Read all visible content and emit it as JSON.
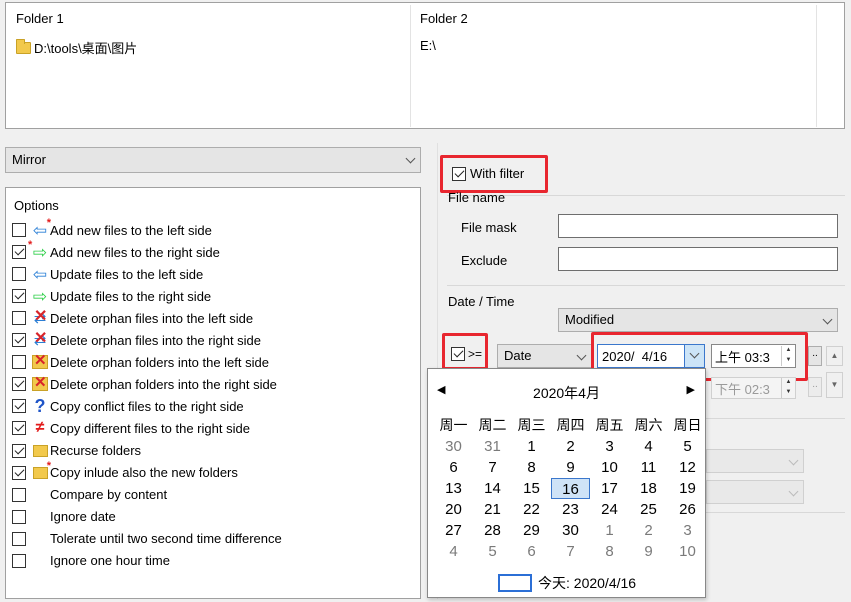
{
  "folders": {
    "left_header": "Folder 1",
    "left_path": "D:\\tools\\桌面\\图片",
    "right_header": "Folder 2",
    "right_path": "E:\\"
  },
  "mode": {
    "selected": "Mirror"
  },
  "options": {
    "title": "Options",
    "items": [
      {
        "label": "Add new files to the left side",
        "checked": false,
        "icon": "add-left-arrow-icon"
      },
      {
        "label": "Add new files to the right side",
        "checked": true,
        "icon": "add-right-arrow-icon"
      },
      {
        "label": "Update files to the left side",
        "checked": false,
        "icon": "left-arrow-icon"
      },
      {
        "label": "Update files to the right side",
        "checked": true,
        "icon": "right-arrow-icon"
      },
      {
        "label": "Delete orphan files into the left side",
        "checked": false,
        "icon": "delete-files-icon"
      },
      {
        "label": "Delete orphan files into the right side",
        "checked": true,
        "icon": "delete-files-icon"
      },
      {
        "label": "Delete orphan folders into the left side",
        "checked": false,
        "icon": "delete-folder-icon"
      },
      {
        "label": "Delete orphan folders into the right side",
        "checked": true,
        "icon": "delete-folder-icon"
      },
      {
        "label": "Copy conflict files to the right side",
        "checked": true,
        "icon": "question-icon"
      },
      {
        "label": "Copy different files to the right side",
        "checked": true,
        "icon": "not-equal-icon"
      },
      {
        "label": "Recurse folders",
        "checked": true,
        "icon": "folder-icon"
      },
      {
        "label": "Copy inlude also the new folders",
        "checked": true,
        "icon": "new-folder-icon"
      },
      {
        "label": "Compare by content",
        "checked": false,
        "icon": ""
      },
      {
        "label": "Ignore date",
        "checked": false,
        "icon": ""
      },
      {
        "label": "Tolerate until two second time difference",
        "checked": false,
        "icon": ""
      },
      {
        "label": "Ignore one hour time",
        "checked": false,
        "icon": ""
      }
    ]
  },
  "filter": {
    "with_filter_label": "With filter",
    "file_name_group": "File name",
    "file_mask_label": "File mask",
    "file_mask_value": "",
    "exclude_label": "Exclude",
    "exclude_value": "",
    "datetime_group": "Date / Time",
    "modified_select": "Modified",
    "op1": ">=",
    "date_type": "Date",
    "date_value": "2020/  4/16",
    "time_value": "上午 03:3",
    "time_value2": "下午 02:3"
  },
  "calendar": {
    "month_title": "2020年4月",
    "weekdays": [
      "周一",
      "周二",
      "周三",
      "周四",
      "周五",
      "周六",
      "周日"
    ],
    "days": [
      [
        "30",
        "31",
        "1",
        "2",
        "3",
        "4",
        "5"
      ],
      [
        "6",
        "7",
        "8",
        "9",
        "10",
        "11",
        "12"
      ],
      [
        "13",
        "14",
        "15",
        "16",
        "17",
        "18",
        "19"
      ],
      [
        "20",
        "21",
        "22",
        "23",
        "24",
        "25",
        "26"
      ],
      [
        "27",
        "28",
        "29",
        "30",
        "1",
        "2",
        "3"
      ],
      [
        "4",
        "5",
        "6",
        "7",
        "8",
        "9",
        "10"
      ]
    ],
    "selected_day": "16",
    "today_label": "今天: 2020/4/16"
  },
  "colors": {
    "highlight_red": "#e8262f",
    "selection_blue": "#3b77cc"
  }
}
